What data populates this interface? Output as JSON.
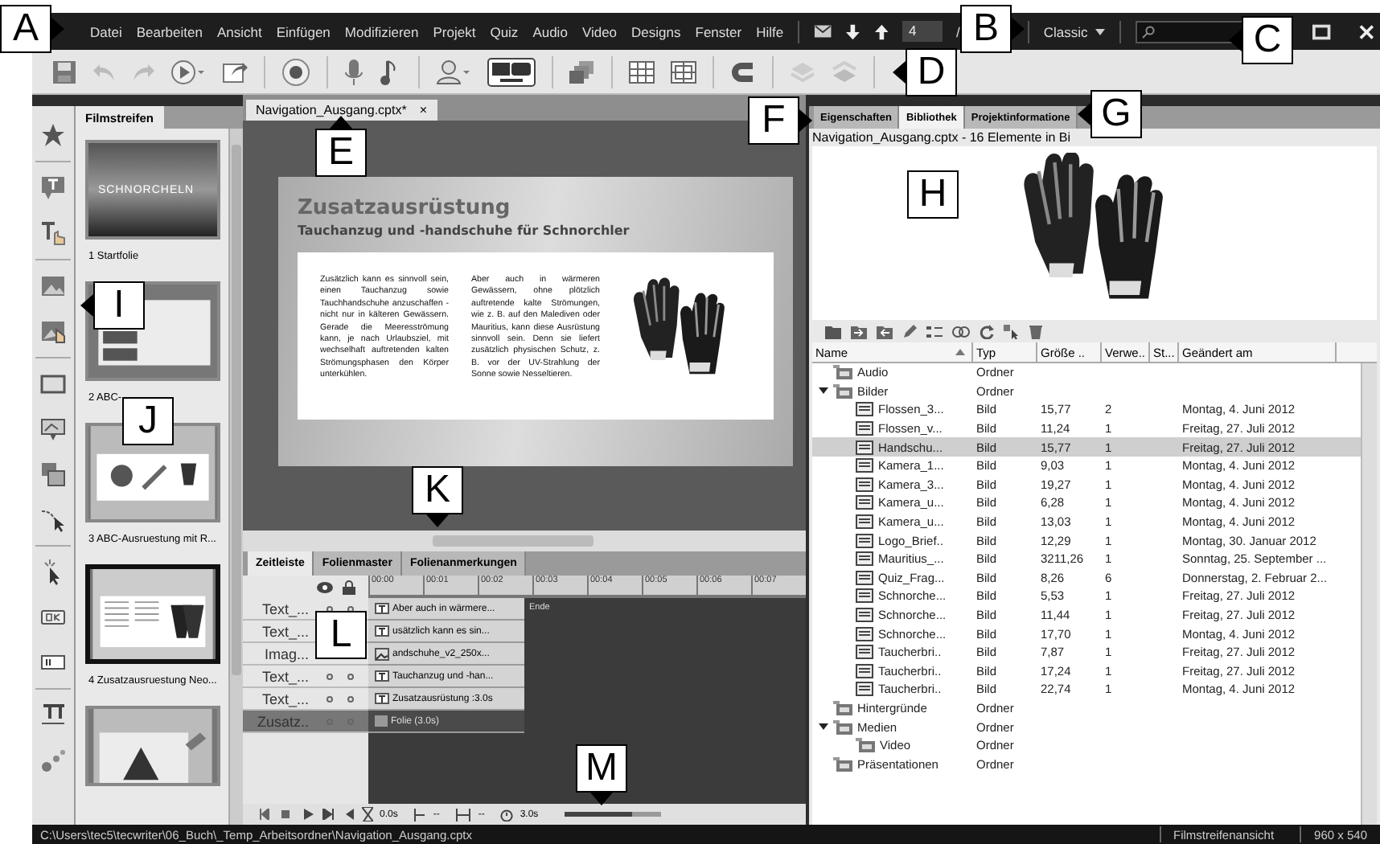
{
  "menu_bar": {
    "items": [
      "Datei",
      "Bearbeiten",
      "Ansicht",
      "Einfügen",
      "Modifizieren",
      "Projekt",
      "Quiz",
      "Audio",
      "Video",
      "Designs",
      "Fenster",
      "Hilfe"
    ],
    "page_field": {
      "value": "4"
    },
    "page_separator": "/",
    "workspace": {
      "label": "Classic"
    }
  },
  "filmstrip": {
    "title": "Filmstreifen",
    "slides": [
      {
        "label": "1 Startfolie",
        "heading": "SCHNORCHELN",
        "selected": false,
        "kind": "title"
      },
      {
        "label": "2 ABC-",
        "selected": false,
        "kind": "menu"
      },
      {
        "label": "3 ABC-Ausruestung mit R...",
        "selected": false,
        "kind": "items"
      },
      {
        "label": "4 Zusatzausruestung Neo...",
        "selected": true,
        "kind": "gloves"
      },
      {
        "selected": false,
        "kind": "diagram"
      }
    ]
  },
  "document_tab": {
    "title": "Navigation_Ausgang.cptx*",
    "close": "×"
  },
  "slide": {
    "title": "Zusatzausrüstung",
    "subtitle": "Tauchanzug und -handschuhe für Schnorchler",
    "paragraphs": [
      "Zusätzlich kann es sinnvoll sein, einen Tauchanzug sowie Tauchhandschuhe anzuschaffen - nicht nur in kälteren Gewässern. Gerade die Meeresströmung kann, je nach Urlaubsziel, mit wechselhaft auftretenden kalten Strömungsphasen den Körper unterkühlen.",
      "Aber auch in wärmeren Gewässern, ohne plötzlich auftretende kalte Strömungen, wie z. B. auf den Malediven oder Mauritius, kann diese Ausrüstung sinnvoll sein. Denn sie liefert zusätzlich physischen Schutz, z. B. vor der UV-Strahlung der Sonne sowie Nesseltieren."
    ]
  },
  "timeline": {
    "tabs": [
      {
        "label": "Zeitleiste",
        "selected": true
      },
      {
        "label": "Folienmaster",
        "selected": false
      },
      {
        "label": "Folienanmerkungen",
        "selected": false
      }
    ],
    "ruler": [
      "00:00",
      "00:01",
      "00:02",
      "00:03",
      "00:04",
      "00:05",
      "00:06",
      "00:07"
    ],
    "layers": [
      {
        "name": "Text_...",
        "bar": "Aber auch in wärmere...",
        "kind": "text",
        "selected": false
      },
      {
        "name": "Text_...",
        "bar": "usätzlich kann es sin...",
        "kind": "text",
        "selected": false
      },
      {
        "name": "Imag...",
        "bar": "andschuhe_v2_250x...",
        "kind": "image",
        "selected": false
      },
      {
        "name": "Text_...",
        "bar": "Tauchanzug und -han...",
        "kind": "text",
        "selected": false
      },
      {
        "name": "Text_...",
        "bar": "Zusatzausrüstung :3.0s",
        "kind": "text",
        "selected": false
      },
      {
        "name": "Zusatz..",
        "bar": "Folie (3.0s)",
        "kind": "slide",
        "selected": true
      }
    ],
    "end_label": "Ende",
    "controls": {
      "start": "0.0s",
      "in_point": "--",
      "out_point": "--",
      "duration": "3.0s"
    },
    "zoom": {
      "level": 0.7
    }
  },
  "library": {
    "tabs": [
      {
        "label": "Eigenschaften",
        "selected": false
      },
      {
        "label": "Bibliothek",
        "selected": true
      },
      {
        "label": "Projektinformatione",
        "selected": false
      }
    ],
    "info": "Navigation_Ausgang.cptx - 16 Elemente in Bi",
    "columns": [
      "Name",
      "Typ",
      "Größe ..",
      "Verwe..",
      "St...",
      "Geändert am"
    ],
    "items": [
      {
        "name": "Audio",
        "type": "Ordner",
        "kind": "folder",
        "selected": false
      },
      {
        "name": "Bilder",
        "type": "Ordner",
        "kind": "folder",
        "selected": false,
        "expanded": true,
        "children": [
          {
            "name": "Flossen_3...",
            "type": "Bild",
            "size": "15,77",
            "uses": "2",
            "modified": "Montag, 4. Juni 2012",
            "kind": "image",
            "selected": false
          },
          {
            "name": "Flossen_v...",
            "type": "Bild",
            "size": "11,24",
            "uses": "1",
            "modified": "Freitag, 27. Juli 2012",
            "kind": "image",
            "selected": false
          },
          {
            "name": "Handschu...",
            "type": "Bild",
            "size": "15,77",
            "uses": "1",
            "modified": "Freitag, 27. Juli 2012",
            "kind": "image",
            "selected": true
          },
          {
            "name": "Kamera_1...",
            "type": "Bild",
            "size": "9,03",
            "uses": "1",
            "modified": "Montag, 4. Juni 2012",
            "kind": "image",
            "selected": false
          },
          {
            "name": "Kamera_3...",
            "type": "Bild",
            "size": "19,27",
            "uses": "1",
            "modified": "Montag, 4. Juni 2012",
            "kind": "image",
            "selected": false
          },
          {
            "name": "Kamera_u...",
            "type": "Bild",
            "size": "6,28",
            "uses": "1",
            "modified": "Montag, 4. Juni 2012",
            "kind": "image",
            "selected": false
          },
          {
            "name": "Kamera_u...",
            "type": "Bild",
            "size": "13,03",
            "uses": "1",
            "modified": "Montag, 4. Juni 2012",
            "kind": "image",
            "selected": false
          },
          {
            "name": "Logo_Brief..",
            "type": "Bild",
            "size": "12,29",
            "uses": "1",
            "modified": "Montag, 30. Januar 2012",
            "kind": "image",
            "selected": false
          },
          {
            "name": "Mauritius_...",
            "type": "Bild",
            "size": "3211,26",
            "uses": "1",
            "modified": "Sonntag, 25. September ...",
            "kind": "image",
            "selected": false
          },
          {
            "name": "Quiz_Frag...",
            "type": "Bild",
            "size": "8,26",
            "uses": "6",
            "modified": "Donnerstag, 2. Februar 2...",
            "kind": "image",
            "selected": false
          },
          {
            "name": "Schnorche...",
            "type": "Bild",
            "size": "5,53",
            "uses": "1",
            "modified": "Freitag, 27. Juli 2012",
            "kind": "image",
            "selected": false
          },
          {
            "name": "Schnorche...",
            "type": "Bild",
            "size": "11,44",
            "uses": "1",
            "modified": "Freitag, 27. Juli 2012",
            "kind": "image",
            "selected": false
          },
          {
            "name": "Schnorche...",
            "type": "Bild",
            "size": "17,70",
            "uses": "1",
            "modified": "Montag, 4. Juni 2012",
            "kind": "image",
            "selected": false
          },
          {
            "name": "Taucherbri..",
            "type": "Bild",
            "size": "7,87",
            "uses": "1",
            "modified": "Freitag, 27. Juli 2012",
            "kind": "image",
            "selected": false
          },
          {
            "name": "Taucherbri..",
            "type": "Bild",
            "size": "17,24",
            "uses": "1",
            "modified": "Freitag, 27. Juli 2012",
            "kind": "image",
            "selected": false
          },
          {
            "name": "Taucherbri..",
            "type": "Bild",
            "size": "22,74",
            "uses": "1",
            "modified": "Montag, 4. Juni 2012",
            "kind": "image",
            "selected": false
          }
        ]
      },
      {
        "name": "Hintergründe",
        "type": "Ordner",
        "kind": "folder",
        "selected": false
      },
      {
        "name": "Medien",
        "type": "Ordner",
        "kind": "folder",
        "selected": false,
        "expanded": true,
        "children": [
          {
            "name": "Video",
            "type": "Ordner",
            "kind": "folder",
            "selected": false
          }
        ]
      },
      {
        "name": "Präsentationen",
        "type": "Ordner",
        "kind": "folder",
        "selected": false
      }
    ]
  },
  "status_bar": {
    "path": "C:\\Users\\tec5\\tecwriter\\06_Buch\\_Temp_Arbeitsordner\\Navigation_Ausgang.cptx",
    "view": "Filmstreifenansicht",
    "size": "960 x 540"
  },
  "callouts": [
    {
      "letter": "A",
      "kind": "right"
    },
    {
      "letter": "B",
      "kind": "right"
    },
    {
      "letter": "C",
      "kind": "left"
    },
    {
      "letter": "D",
      "kind": "left"
    },
    {
      "letter": "E",
      "kind": "up"
    },
    {
      "letter": "F",
      "kind": "right"
    },
    {
      "letter": "G",
      "kind": "left"
    },
    {
      "letter": "H",
      "kind": "plain"
    },
    {
      "letter": "I",
      "kind": "left"
    },
    {
      "letter": "J",
      "kind": "plain"
    },
    {
      "letter": "K",
      "kind": "down"
    },
    {
      "letter": "L",
      "kind": "plain"
    },
    {
      "letter": "M",
      "kind": "down"
    }
  ]
}
